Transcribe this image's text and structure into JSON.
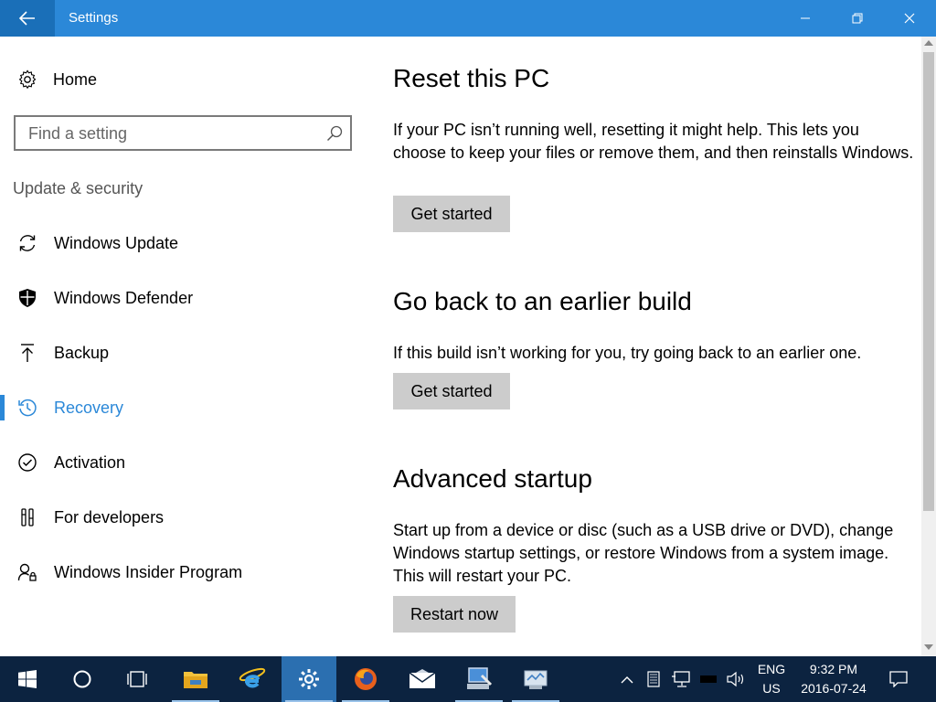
{
  "window": {
    "title": "Settings",
    "minimize": "minimize",
    "maximize": "restore",
    "close": "close"
  },
  "sidebar": {
    "home_label": "Home",
    "search_placeholder": "Find a setting",
    "section_label": "Update & security",
    "items": [
      {
        "label": "Windows Update",
        "icon": "sync-icon",
        "active": false
      },
      {
        "label": "Windows Defender",
        "icon": "shield-icon",
        "active": false
      },
      {
        "label": "Backup",
        "icon": "upload-arrow-icon",
        "active": false
      },
      {
        "label": "Recovery",
        "icon": "history-icon",
        "active": true
      },
      {
        "label": "Activation",
        "icon": "checkmark-circle-icon",
        "active": false
      },
      {
        "label": "For developers",
        "icon": "developer-tools-icon",
        "active": false
      },
      {
        "label": "Windows Insider Program",
        "icon": "insider-person-icon",
        "active": false
      }
    ]
  },
  "main": {
    "reset": {
      "heading": "Reset this PC",
      "description": "If your PC isn’t running well, resetting it might help. This lets you choose to keep your files or remove them, and then reinstalls Windows.",
      "button": "Get started"
    },
    "go_back": {
      "heading": "Go back to an earlier build",
      "description": "If this build isn’t working for you, try going back to an earlier one.",
      "button": "Get started"
    },
    "advanced": {
      "heading": "Advanced startup",
      "description": "Start up from a device or disc (such as a USB drive or DVD), change Windows startup settings, or restore Windows from a system image. This will restart your PC.",
      "button": "Restart now"
    }
  },
  "taskbar": {
    "apps": [
      "start-icon",
      "cortana-icon",
      "task-view-icon",
      "file-explorer-icon",
      "edge-icon",
      "settings-icon",
      "firefox-icon",
      "mail-icon",
      "network-app-icon",
      "control-panel-icon"
    ],
    "language_line1": "ENG",
    "language_line2": "US",
    "time": "9:32 PM",
    "date": "2016-07-24"
  },
  "colors": {
    "accent": "#2b88d8",
    "titlebar": "#2b88d8",
    "taskbar": "#0c2340",
    "button_bg": "#cccccc"
  }
}
